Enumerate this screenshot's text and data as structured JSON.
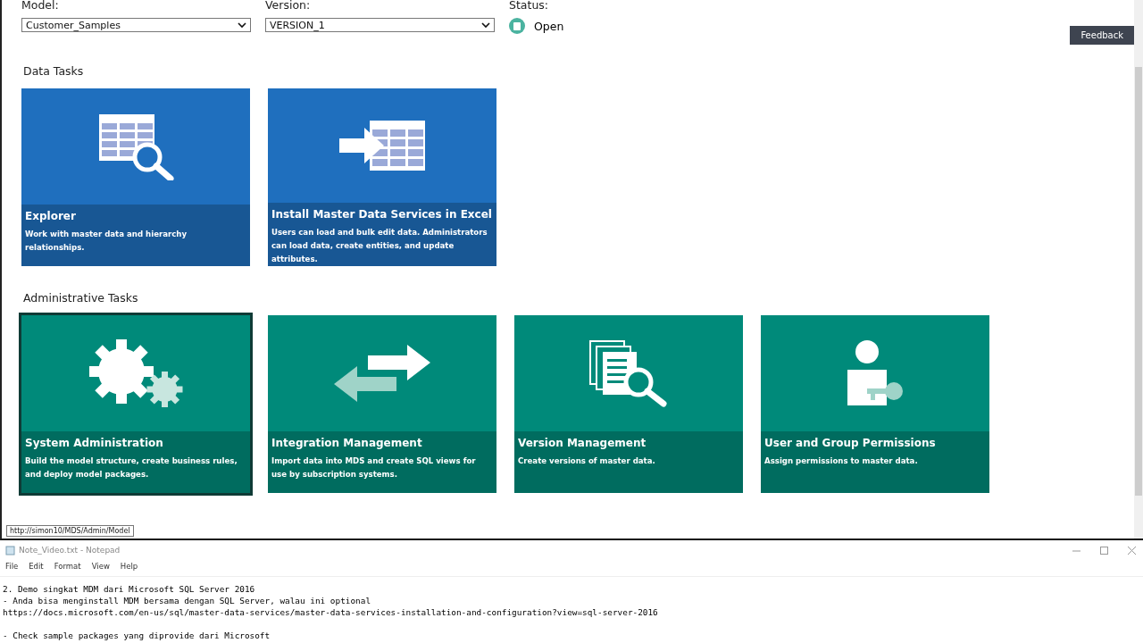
{
  "header": {
    "model": {
      "label": "Model:",
      "value": "Customer_Samples"
    },
    "version": {
      "label": "Version:",
      "value": "VERSION_1"
    },
    "status": {
      "label": "Status:",
      "value": "Open"
    },
    "feedback": "Feedback"
  },
  "sections": [
    {
      "title": "Data Tasks",
      "color": "#1f6fbe",
      "tiles": [
        {
          "kind": "explorer",
          "title": "Explorer",
          "description": "Work with master data and hierarchy relationships.",
          "selected": false
        },
        {
          "kind": "excel",
          "title": "Install Master Data Services in Excel",
          "description": "Users can load and bulk edit data. Administrators can load data, create entities, and update attributes.",
          "selected": false
        }
      ]
    },
    {
      "title": "Administrative Tasks",
      "color": "#008a7a",
      "tiles": [
        {
          "kind": "gears",
          "title": "System Administration",
          "description": "Build the model structure, create business rules, and deploy model packages.",
          "selected": true
        },
        {
          "kind": "arrows",
          "title": "Integration Management",
          "description": "Import data into MDS and create SQL views for use by subscription systems.",
          "selected": false
        },
        {
          "kind": "documents",
          "title": "Version Management",
          "description": "Create versions of master data.",
          "selected": false
        },
        {
          "kind": "user-key",
          "title": "User and Group Permissions",
          "description": "Assign permissions to master data.",
          "selected": false
        }
      ]
    }
  ],
  "tooltip": "http://simon10/MDS/Admin/Model",
  "notepad": {
    "title": "Note_Video.txt - Notepad",
    "menu": [
      "File",
      "Edit",
      "Format",
      "View",
      "Help"
    ],
    "paragraphs": [
      [
        "2. Demo singkat MDM dari Microsoft SQL Server 2016",
        "- Anda bisa menginstall MDM bersama dengan SQL Server, walau ini optional",
        "https://docs.microsoft.com/en-us/sql/master-data-services/master-data-services-installation-and-configuration?view=sql-server-2016"
      ],
      [
        "- Check sample packages yang diprovide dari Microsoft"
      ]
    ]
  }
}
